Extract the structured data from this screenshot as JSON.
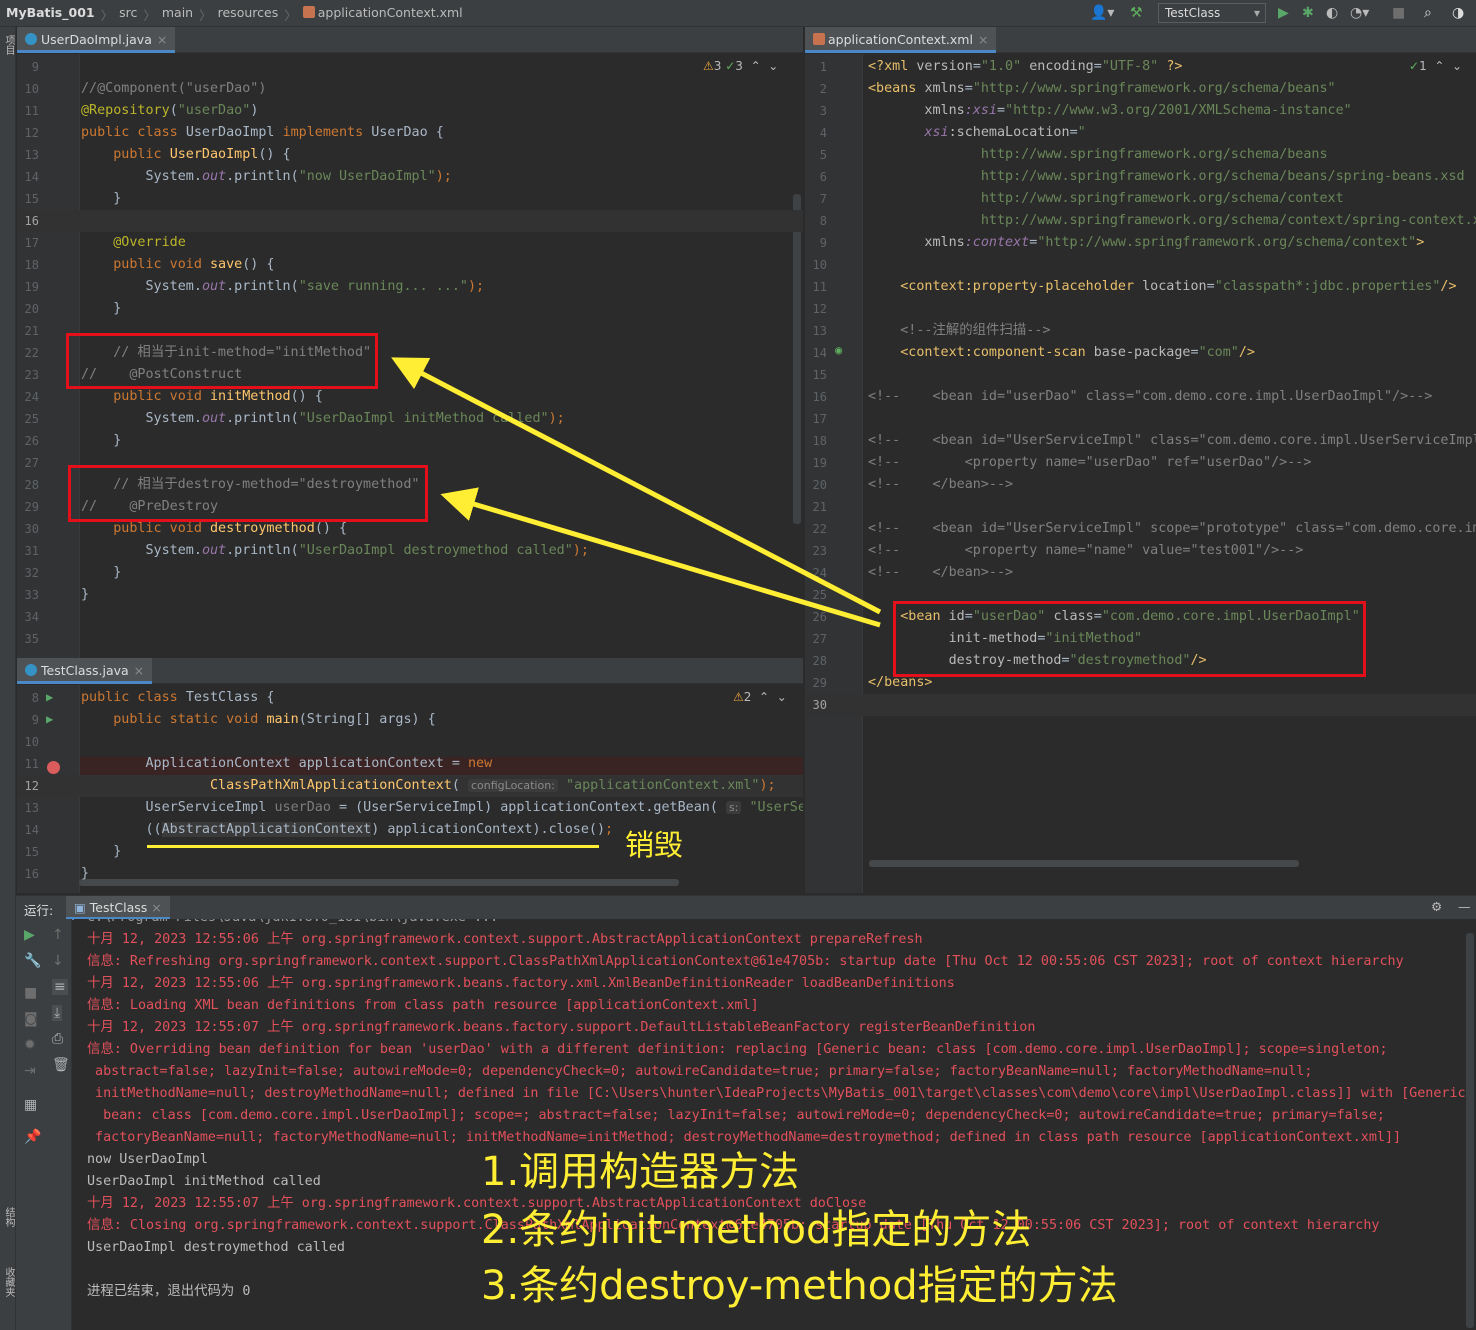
{
  "breadcrumb": {
    "project": "MyBatis_001",
    "items": [
      "src",
      "main",
      "resources"
    ],
    "file": "applicationContext.xml"
  },
  "run_config": "TestClass",
  "side_labels": {
    "project": "项目",
    "structure": "结构",
    "favorites": "收藏夹"
  },
  "left_editor": {
    "tab": "UserDaoImpl.java",
    "inspections": {
      "warnings": "3",
      "ok": "3"
    },
    "lines": [
      {
        "n": "9",
        "segs": []
      },
      {
        "n": "10",
        "segs": [
          {
            "t": "//@Component(\"userDao\")",
            "c": "cmt"
          }
        ]
      },
      {
        "n": "11",
        "segs": [
          {
            "t": "@Repository",
            "c": "ann"
          },
          {
            "t": "(",
            "c": ""
          },
          {
            "t": "\"userDao\"",
            "c": "str"
          },
          {
            "t": ")",
            "c": ""
          }
        ]
      },
      {
        "n": "12",
        "segs": [
          {
            "t": "public class ",
            "c": "kw"
          },
          {
            "t": "UserDaoImpl ",
            "c": ""
          },
          {
            "t": "implements ",
            "c": "kw"
          },
          {
            "t": "UserDao {",
            "c": ""
          }
        ]
      },
      {
        "n": "13",
        "segs": [
          {
            "t": "    public ",
            "c": "kw"
          },
          {
            "t": "UserDaoImpl",
            "c": "fn"
          },
          {
            "t": "() {",
            "c": ""
          }
        ]
      },
      {
        "n": "14",
        "segs": [
          {
            "t": "        System.",
            "c": ""
          },
          {
            "t": "out",
            "c": "it"
          },
          {
            "t": ".println(",
            "c": ""
          },
          {
            "t": "\"now UserDaoImpl\"",
            "c": "str"
          },
          {
            "t": ");",
            "c": "kw"
          }
        ]
      },
      {
        "n": "15",
        "segs": [
          {
            "t": "    }",
            "c": ""
          }
        ]
      },
      {
        "n": "16",
        "segs": [],
        "cur": true
      },
      {
        "n": "17",
        "segs": [
          {
            "t": "    @Override",
            "c": "ann"
          }
        ]
      },
      {
        "n": "18",
        "segs": [
          {
            "t": "    public void ",
            "c": "kw"
          },
          {
            "t": "save",
            "c": "fn"
          },
          {
            "t": "() {",
            "c": ""
          }
        ]
      },
      {
        "n": "19",
        "segs": [
          {
            "t": "        System.",
            "c": ""
          },
          {
            "t": "out",
            "c": "it"
          },
          {
            "t": ".println(",
            "c": ""
          },
          {
            "t": "\"save running... ...\"",
            "c": "str"
          },
          {
            "t": ");",
            "c": "kw"
          }
        ]
      },
      {
        "n": "20",
        "segs": [
          {
            "t": "    }",
            "c": ""
          }
        ]
      },
      {
        "n": "21",
        "segs": []
      },
      {
        "n": "22",
        "segs": [
          {
            "t": "    // 相当于init-method=\"initMethod\"",
            "c": "cmt"
          }
        ]
      },
      {
        "n": "23",
        "segs": [
          {
            "t": "//    @PostConstruct",
            "c": "cmt"
          }
        ]
      },
      {
        "n": "24",
        "segs": [
          {
            "t": "    public void ",
            "c": "kw"
          },
          {
            "t": "initMethod",
            "c": "fn"
          },
          {
            "t": "() {",
            "c": ""
          }
        ]
      },
      {
        "n": "25",
        "segs": [
          {
            "t": "        System.",
            "c": ""
          },
          {
            "t": "out",
            "c": "it"
          },
          {
            "t": ".println(",
            "c": ""
          },
          {
            "t": "\"UserDaoImpl initMethod called\"",
            "c": "str"
          },
          {
            "t": ");",
            "c": "kw"
          }
        ]
      },
      {
        "n": "26",
        "segs": [
          {
            "t": "    }",
            "c": ""
          }
        ]
      },
      {
        "n": "27",
        "segs": []
      },
      {
        "n": "28",
        "segs": [
          {
            "t": "    // 相当于destroy-method=\"destroymethod\"",
            "c": "cmt"
          }
        ]
      },
      {
        "n": "29",
        "segs": [
          {
            "t": "//    @PreDestroy",
            "c": "cmt"
          }
        ]
      },
      {
        "n": "30",
        "segs": [
          {
            "t": "    public void ",
            "c": "kw"
          },
          {
            "t": "destroymethod",
            "c": "fn"
          },
          {
            "t": "() {",
            "c": ""
          }
        ]
      },
      {
        "n": "31",
        "segs": [
          {
            "t": "        System.",
            "c": ""
          },
          {
            "t": "out",
            "c": "it"
          },
          {
            "t": ".println(",
            "c": ""
          },
          {
            "t": "\"UserDaoImpl destroymethod called\"",
            "c": "str"
          },
          {
            "t": ");",
            "c": "kw"
          }
        ]
      },
      {
        "n": "32",
        "segs": [
          {
            "t": "    }",
            "c": ""
          }
        ]
      },
      {
        "n": "33",
        "segs": [
          {
            "t": "}",
            "c": ""
          }
        ]
      },
      {
        "n": "34",
        "segs": []
      },
      {
        "n": "35",
        "segs": []
      }
    ]
  },
  "test_editor": {
    "tab": "TestClass.java",
    "inspections": {
      "warnings": "2"
    },
    "lines": [
      {
        "n": "8",
        "segs": [
          {
            "t": "public class ",
            "c": "kw"
          },
          {
            "t": "TestClass {",
            "c": ""
          }
        ]
      },
      {
        "n": "9",
        "segs": [
          {
            "t": "    public static void ",
            "c": "kw"
          },
          {
            "t": "main",
            "c": "fn"
          },
          {
            "t": "(String[] args) {",
            "c": ""
          }
        ]
      },
      {
        "n": "10",
        "segs": []
      },
      {
        "n": "11",
        "segs": [
          {
            "t": "        ApplicationContext applicationContext = ",
            "c": ""
          },
          {
            "t": "new",
            "c": "kw"
          }
        ]
      },
      {
        "n": "12",
        "segs": [
          {
            "t": "                ",
            "c": ""
          },
          {
            "t": "ClassPathXmlApplicationContext",
            "c": "fn"
          },
          {
            "t": "( ",
            "c": ""
          },
          {
            "t": "configLocation:",
            "c": "hint"
          },
          {
            "t": " \"applicationContext.xml\"",
            "c": "str"
          },
          {
            "t": ");",
            "c": "kw"
          }
        ],
        "cur": true
      },
      {
        "n": "13",
        "segs": [
          {
            "t": "        UserServiceImpl ",
            "c": ""
          },
          {
            "t": "userDao",
            "c": "dim"
          },
          {
            "t": " = (UserServiceImpl) applicationContext.getBean( ",
            "c": ""
          },
          {
            "t": "s:",
            "c": "hint"
          },
          {
            "t": " \"UserServiceImpl\"",
            "c": "str"
          }
        ]
      },
      {
        "n": "14",
        "segs": [
          {
            "t": "        ((",
            "c": ""
          },
          {
            "t": "AbstractApplicationContext",
            "c": "grayhl"
          },
          {
            "t": ") applicationContext).close()",
            "c": ""
          },
          {
            "t": ";",
            "c": "kw"
          }
        ]
      },
      {
        "n": "15",
        "segs": [
          {
            "t": "    }",
            "c": ""
          }
        ]
      },
      {
        "n": "16",
        "segs": [
          {
            "t": "}",
            "c": ""
          }
        ]
      }
    ]
  },
  "xml_editor": {
    "tab": "applicationContext.xml",
    "inspections": {
      "ok": "1"
    },
    "lines": [
      {
        "n": "1",
        "segs": [
          {
            "t": "<?xml ",
            "c": "tag"
          },
          {
            "t": "version",
            "c": "attr"
          },
          {
            "t": "=",
            "c": ""
          },
          {
            "t": "\"1.0\" ",
            "c": "str"
          },
          {
            "t": "encoding",
            "c": "attr"
          },
          {
            "t": "=",
            "c": ""
          },
          {
            "t": "\"UTF-8\" ",
            "c": "str"
          },
          {
            "t": "?>",
            "c": "tag"
          }
        ]
      },
      {
        "n": "2",
        "segs": [
          {
            "t": "<beans ",
            "c": "tag"
          },
          {
            "t": "xmlns",
            "c": "attr"
          },
          {
            "t": "=",
            "c": ""
          },
          {
            "t": "\"http://www.springframework.org/schema/beans\"",
            "c": "str"
          }
        ]
      },
      {
        "n": "3",
        "segs": [
          {
            "t": "       xmlns",
            "c": "attr"
          },
          {
            "t": ":xsi",
            "c": "it"
          },
          {
            "t": "=",
            "c": ""
          },
          {
            "t": "\"http://www.w3.org/2001/XMLSchema-instance\"",
            "c": "str"
          }
        ]
      },
      {
        "n": "4",
        "segs": [
          {
            "t": "       xsi",
            "c": "it"
          },
          {
            "t": ":schemaLocation",
            "c": "attr"
          },
          {
            "t": "=",
            "c": ""
          },
          {
            "t": "\"",
            "c": "str"
          }
        ]
      },
      {
        "n": "5",
        "segs": [
          {
            "t": "              http://www.springframework.org/schema/beans",
            "c": "str"
          }
        ]
      },
      {
        "n": "6",
        "segs": [
          {
            "t": "              http://www.springframework.org/schema/beans/spring-beans.xsd",
            "c": "str"
          }
        ]
      },
      {
        "n": "7",
        "segs": [
          {
            "t": "              http://www.springframework.org/schema/context",
            "c": "str"
          }
        ]
      },
      {
        "n": "8",
        "segs": [
          {
            "t": "              http://www.springframework.org/schema/context/spring-context.xsd\"",
            "c": "str"
          }
        ]
      },
      {
        "n": "9",
        "segs": [
          {
            "t": "       xmlns",
            "c": "attr"
          },
          {
            "t": ":context",
            "c": "it"
          },
          {
            "t": "=",
            "c": ""
          },
          {
            "t": "\"http://www.springframework.org/schema/context\"",
            "c": "str"
          },
          {
            "t": ">",
            "c": "tag"
          }
        ]
      },
      {
        "n": "10",
        "segs": []
      },
      {
        "n": "11",
        "segs": [
          {
            "t": "    <context",
            "c": "tag"
          },
          {
            "t": ":property-placeholder ",
            "c": "tag"
          },
          {
            "t": "location",
            "c": "attr"
          },
          {
            "t": "=",
            "c": ""
          },
          {
            "t": "\"classpath*:jdbc.properties\"",
            "c": "str"
          },
          {
            "t": "/>",
            "c": "tag"
          }
        ]
      },
      {
        "n": "12",
        "segs": []
      },
      {
        "n": "13",
        "segs": [
          {
            "t": "    <!--注解的组件扫描-->",
            "c": "cmt"
          }
        ]
      },
      {
        "n": "14",
        "segs": [
          {
            "t": "    <context",
            "c": "tag"
          },
          {
            "t": ":component-scan ",
            "c": "tag"
          },
          {
            "t": "base-package",
            "c": "attr"
          },
          {
            "t": "=",
            "c": ""
          },
          {
            "t": "\"com\"",
            "c": "str"
          },
          {
            "t": "/>",
            "c": "tag"
          }
        ]
      },
      {
        "n": "15",
        "segs": []
      },
      {
        "n": "16",
        "segs": [
          {
            "t": "<!--    <bean id=\"userDao\" class=\"com.demo.core.impl.UserDaoImpl\"/>-->",
            "c": "cmt"
          }
        ]
      },
      {
        "n": "17",
        "segs": []
      },
      {
        "n": "18",
        "segs": [
          {
            "t": "<!--    <bean id=\"UserServiceImpl\" class=\"com.demo.core.impl.UserServiceImpl\">-->",
            "c": "cmt"
          }
        ]
      },
      {
        "n": "19",
        "segs": [
          {
            "t": "<!--        <property name=\"userDao\" ref=\"userDao\"/>-->",
            "c": "cmt"
          }
        ]
      },
      {
        "n": "20",
        "segs": [
          {
            "t": "<!--    </bean>-->",
            "c": "cmt"
          }
        ]
      },
      {
        "n": "21",
        "segs": []
      },
      {
        "n": "22",
        "segs": [
          {
            "t": "<!--    <bean id=\"UserServiceImpl\" scope=\"prototype\" class=\"com.demo.core.impl.UserServiceImpl\">-->",
            "c": "cmt"
          }
        ]
      },
      {
        "n": "23",
        "segs": [
          {
            "t": "<!--        <property name=\"name\" value=\"test001\"/>-->",
            "c": "cmt"
          }
        ]
      },
      {
        "n": "24",
        "segs": [
          {
            "t": "<!--    </bean>-->",
            "c": "cmt"
          }
        ]
      },
      {
        "n": "25",
        "segs": []
      },
      {
        "n": "26",
        "segs": [
          {
            "t": "    <bean ",
            "c": "tag"
          },
          {
            "t": "id",
            "c": "attr"
          },
          {
            "t": "=",
            "c": ""
          },
          {
            "t": "\"userDao\" ",
            "c": "str"
          },
          {
            "t": "class",
            "c": "attr"
          },
          {
            "t": "=",
            "c": ""
          },
          {
            "t": "\"com.demo.core.impl.UserDaoImpl\"",
            "c": "str"
          }
        ]
      },
      {
        "n": "27",
        "segs": [
          {
            "t": "          init-method",
            "c": "attr"
          },
          {
            "t": "=",
            "c": ""
          },
          {
            "t": "\"initMethod\"",
            "c": "str"
          }
        ]
      },
      {
        "n": "28",
        "segs": [
          {
            "t": "          destroy-method",
            "c": "attr"
          },
          {
            "t": "=",
            "c": ""
          },
          {
            "t": "\"destroymethod\"",
            "c": "str"
          },
          {
            "t": "/>",
            "c": "tag"
          }
        ]
      },
      {
        "n": "29",
        "segs": [
          {
            "t": "</beans>",
            "c": "tag"
          }
        ]
      },
      {
        "n": "30",
        "segs": [],
        "cur": true
      }
    ]
  },
  "run_window": {
    "label": "运行:",
    "tab": "TestClass",
    "lines": [
      {
        "t": "C:\\Program Files\\Java\\jdk1.8.0_181\\bin\\java.exe ...",
        "c": "gray"
      },
      {
        "t": "十月 12, 2023 12:55:06 上午 org.springframework.context.support.AbstractApplicationContext prepareRefresh",
        "c": "red"
      },
      {
        "t": "信息: Refreshing org.springframework.context.support.ClassPathXmlApplicationContext@61e4705b: startup date [Thu Oct 12 00:55:06 CST 2023]; root of context hierarchy",
        "c": "red"
      },
      {
        "t": "十月 12, 2023 12:55:06 上午 org.springframework.beans.factory.xml.XmlBeanDefinitionReader loadBeanDefinitions",
        "c": "red"
      },
      {
        "t": "信息: Loading XML bean definitions from class path resource [applicationContext.xml]",
        "c": "red"
      },
      {
        "t": "十月 12, 2023 12:55:07 上午 org.springframework.beans.factory.support.DefaultListableBeanFactory registerBeanDefinition",
        "c": "red"
      },
      {
        "t": "信息: Overriding bean definition for bean 'userDao' with a different definition: replacing [Generic bean: class [com.demo.core.impl.UserDaoImpl]; scope=singleton;",
        "c": "red"
      },
      {
        "t": " abstract=false; lazyInit=false; autowireMode=0; dependencyCheck=0; autowireCandidate=true; primary=false; factoryBeanName=null; factoryMethodName=null;",
        "c": "red"
      },
      {
        "t": " initMethodName=null; destroyMethodName=null; defined in file [C:\\Users\\hunter\\IdeaProjects\\MyBatis_001\\target\\classes\\com\\demo\\core\\impl\\UserDaoImpl.class]] with [Generic",
        "c": "red"
      },
      {
        "t": "  bean: class [com.demo.core.impl.UserDaoImpl]; scope=; abstract=false; lazyInit=false; autowireMode=0; dependencyCheck=0; autowireCandidate=true; primary=false;",
        "c": "red"
      },
      {
        "t": " factoryBeanName=null; factoryMethodName=null; initMethodName=initMethod; destroyMethodName=destroymethod; defined in class path resource [applicationContext.xml]]",
        "c": "red"
      },
      {
        "t": "now UserDaoImpl",
        "c": "norm"
      },
      {
        "t": "UserDaoImpl initMethod called",
        "c": "norm"
      },
      {
        "t": "十月 12, 2023 12:55:07 上午 org.springframework.context.support.AbstractApplicationContext doClose",
        "c": "red"
      },
      {
        "t": "信息: Closing org.springframework.context.support.ClassPathXmlApplicationContext@61e4705b: startup date [Thu Oct 12 00:55:06 CST 2023]; root of context hierarchy",
        "c": "red"
      },
      {
        "t": "UserDaoImpl destroymethod called",
        "c": "norm"
      },
      {
        "t": "",
        "c": "norm"
      },
      {
        "t": "进程已结束，退出代码为 0",
        "c": "norm"
      }
    ]
  },
  "annotations": {
    "destroy_label": "销毁",
    "step1": "1.调用构造器方法",
    "step2": "2.条约init-method指定的方法",
    "step3": "3.条约destroy-method指定的方法",
    "highlight_color": "#ffee33",
    "box_color": "#e3101b"
  }
}
